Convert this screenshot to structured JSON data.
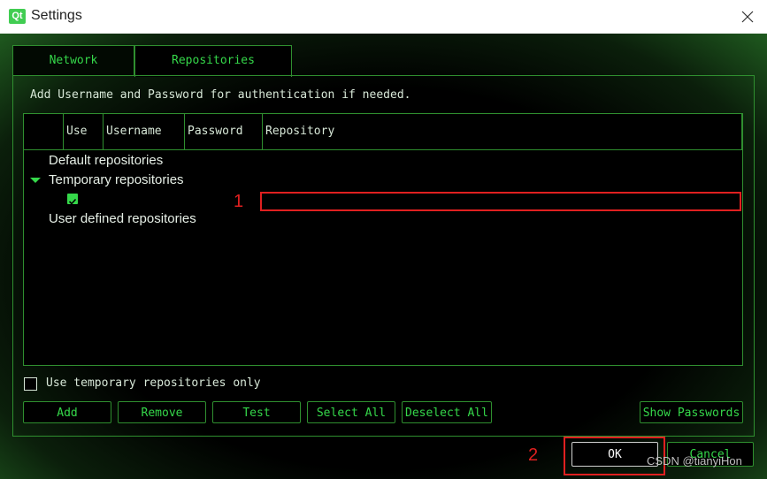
{
  "window": {
    "title": "Settings",
    "logo_text": "Qt"
  },
  "tabs": [
    {
      "label": "Network",
      "active": false
    },
    {
      "label": "Repositories",
      "active": true
    }
  ],
  "hint": "Add Username and Password for authentication if needed.",
  "table": {
    "columns": [
      "",
      "Use",
      "Username",
      "Password",
      "Repository"
    ],
    "rows": [
      {
        "label": "Default repositories"
      },
      {
        "label": "Temporary repositories",
        "expanded": true
      },
      {
        "label": "",
        "checked": true
      },
      {
        "label": "User defined repositories"
      }
    ]
  },
  "temporary_only": {
    "label": "Use temporary repositories only",
    "checked": false
  },
  "buttons": {
    "add": "Add",
    "remove": "Remove",
    "test": "Test",
    "select_all": "Select All",
    "deselect_all": "Deselect All",
    "show_passwords": "Show Passwords",
    "ok": "OK",
    "cancel": "Cancel"
  },
  "annotations": {
    "one": "1",
    "two": "2"
  },
  "watermark": "CSDN @tianyiHon",
  "colors": {
    "accent": "#35d84a",
    "border": "#2f8f2f",
    "highlight": "#e02020"
  }
}
